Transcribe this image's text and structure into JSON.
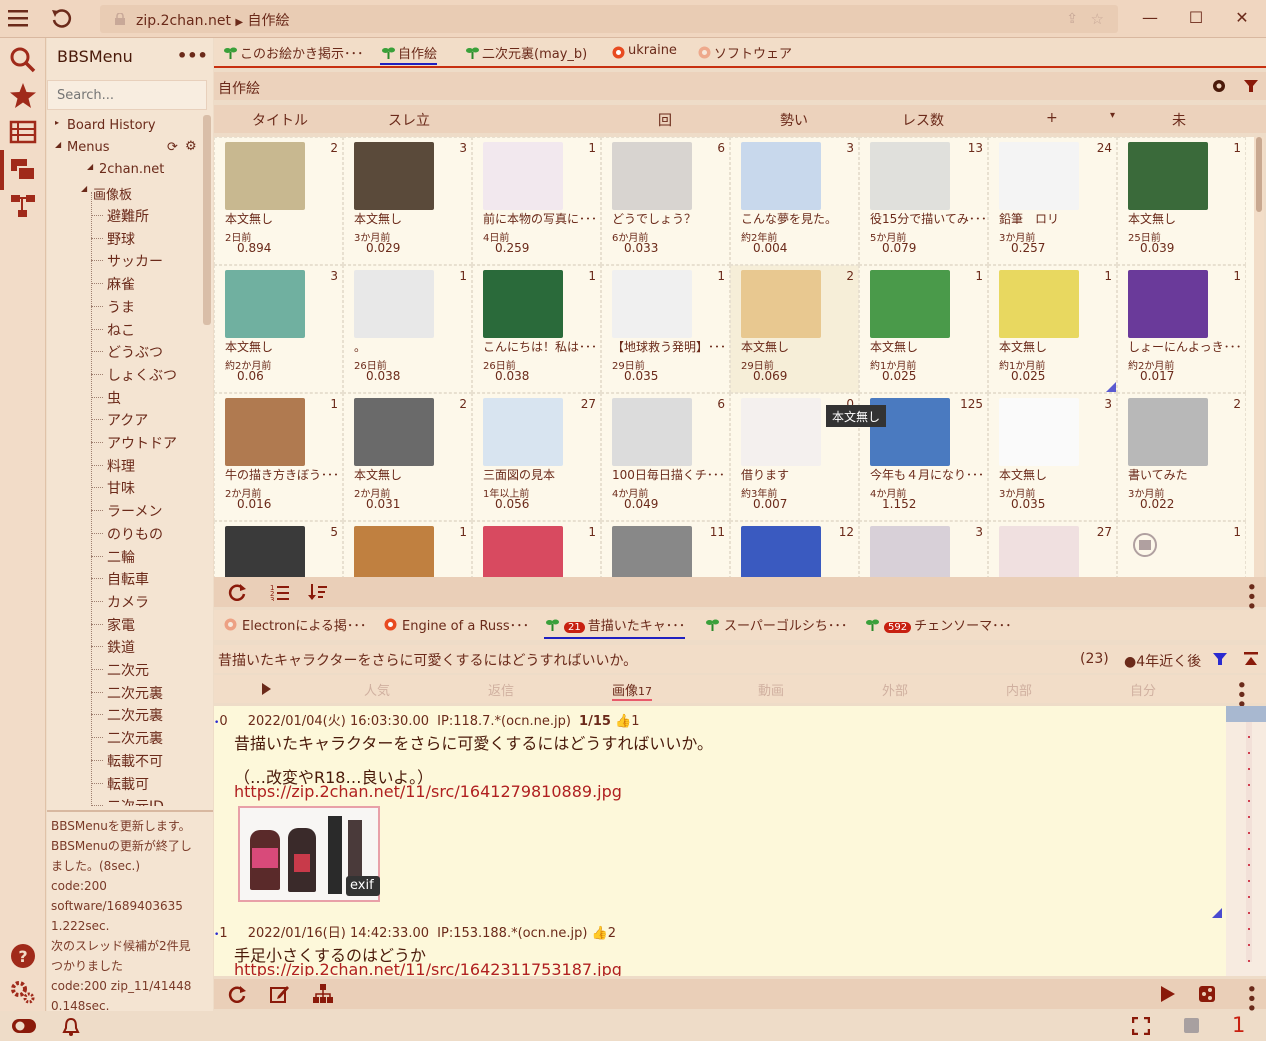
{
  "titlebar": {
    "address": "zip.2chan.net",
    "crumb": "自作絵"
  },
  "sidebar": {
    "title": "BBSMenu",
    "search_placeholder": "Search...",
    "tree": {
      "board_history": "Board History",
      "menus": "Menus",
      "site": "2chan.net",
      "category": "画像板",
      "boards": [
        "避難所",
        "野球",
        "サッカー",
        "麻雀",
        "うま",
        "ねこ",
        "どうぶつ",
        "しょくぶつ",
        "虫",
        "アクア",
        "アウトドア",
        "料理",
        "甘味",
        "ラーメン",
        "のりもの",
        "二輪",
        "自転車",
        "カメラ",
        "家電",
        "鉄道",
        "二次元",
        "二次元裏",
        "二次元裏",
        "二次元裏",
        "転載不可",
        "転載可",
        "二次元ID"
      ]
    },
    "log": [
      "BBSMenuを更新します。",
      "BBSMenuの更新が終了し",
      "ました。(8sec.)",
      "code:200",
      "software/1689403635",
      "1.222sec.",
      "次のスレッド候補が2件見",
      "つかりました",
      "code:200 zip_11/41448",
      "0.148sec."
    ]
  },
  "board_tabs": [
    {
      "label": "このお絵かき掲示･･･",
      "icon": "sprout-icon"
    },
    {
      "label": "自作絵",
      "icon": "sprout-icon",
      "active": true
    },
    {
      "label": "二次元裏(may_b)",
      "icon": "sprout-icon"
    },
    {
      "label": "ukraine",
      "icon": "record-icon"
    },
    {
      "label": "ソフトウェア",
      "icon": "record-icon"
    }
  ],
  "board": {
    "title": "自作絵",
    "columns": [
      "タイトル",
      "スレ立",
      "回",
      "勢い",
      "レス数",
      "+",
      "▾",
      "未"
    ]
  },
  "threads": [
    {
      "title": "本文無し",
      "age": "2日前",
      "speed": "0.894",
      "count": "2",
      "thumb": "#c8b890"
    },
    {
      "title": "本文無し",
      "age": "3か月前",
      "speed": "0.029",
      "count": "3",
      "thumb": "#5a4a3a"
    },
    {
      "title": "前に本物の写真に･･･",
      "age": "4日前",
      "speed": "0.259",
      "count": "1",
      "thumb": "#f2e8ee"
    },
    {
      "title": "どうでしょう？",
      "age": "6か月前",
      "speed": "0.033",
      "count": "6",
      "thumb": "#d8d4d0"
    },
    {
      "title": "こんな夢を見た。",
      "age": "約2年前",
      "speed": "0.004",
      "count": "3",
      "thumb": "#c8d8ec"
    },
    {
      "title": "役15分で描いてみ･･･",
      "age": "5か月前",
      "speed": "0.079",
      "count": "13",
      "thumb": "#e0e0dc"
    },
    {
      "title": "鉛筆　ロリ",
      "age": "3か月前",
      "speed": "0.257",
      "count": "24",
      "thumb": "#f4f4f4"
    },
    {
      "title": "本文無し",
      "age": "25日前",
      "speed": "0.039",
      "count": "1",
      "thumb": "#3a6a3a"
    },
    {
      "title": "本文無し",
      "age": "約2か月前",
      "speed": "0.06",
      "count": "3",
      "thumb": "#70b0a0"
    },
    {
      "title": "。",
      "age": "26日前",
      "speed": "0.038",
      "count": "1",
      "thumb": "#e8e8e8"
    },
    {
      "title": "こんにちは！私は･･･",
      "age": "26日前",
      "speed": "0.038",
      "count": "1",
      "thumb": "#2a6a3a"
    },
    {
      "title": "【地球救う発明】･･･",
      "age": "29日前",
      "speed": "0.035",
      "count": "1",
      "thumb": "#f0f0f0"
    },
    {
      "title": "本文無し",
      "age": "29日前",
      "speed": "0.069",
      "count": "2",
      "thumb": "#e8c890"
    },
    {
      "title": "本文無し",
      "age": "約1か月前",
      "speed": "0.025",
      "count": "1",
      "thumb": "#4a9a4a"
    },
    {
      "title": "本文無し",
      "age": "約1か月前",
      "speed": "0.025",
      "count": "1",
      "thumb": "#e8d860"
    },
    {
      "title": "しょーにんよっき･･･",
      "age": "約2か月前",
      "speed": "0.017",
      "count": "1",
      "thumb": "#6a3a9a"
    },
    {
      "title": "牛の描き方きぼう･･･",
      "age": "2か月前",
      "speed": "0.016",
      "count": "1",
      "thumb": "#b07a50"
    },
    {
      "title": "本文無し",
      "age": "2か月前",
      "speed": "0.031",
      "count": "2",
      "thumb": "#6a6a6a"
    },
    {
      "title": "三面図の見本",
      "age": "1年以上前",
      "speed": "0.056",
      "count": "27",
      "thumb": "#d8e4f0"
    },
    {
      "title": "100日毎日描くチ･･･",
      "age": "4か月前",
      "speed": "0.049",
      "count": "6",
      "thumb": "#dcdcdc"
    },
    {
      "title": "借ります",
      "age": "約3年前",
      "speed": "0.007",
      "count": "0",
      "thumb": "#f4f0ee"
    },
    {
      "title": "今年も４月になり･･･",
      "age": "4か月前",
      "speed": "1.152",
      "count": "125",
      "thumb": "#4a7ac0"
    },
    {
      "title": "本文無し",
      "age": "3か月前",
      "speed": "0.035",
      "count": "3",
      "thumb": "#fafafa"
    },
    {
      "title": "書いてみた",
      "age": "3か月前",
      "speed": "0.022",
      "count": "2",
      "thumb": "#b8b8b8"
    },
    {
      "title": "",
      "age": "",
      "speed": "",
      "count": "5",
      "thumb": "#3a3a3a"
    },
    {
      "title": "",
      "age": "",
      "speed": "",
      "count": "1",
      "thumb": "#c08040"
    },
    {
      "title": "",
      "age": "",
      "speed": "",
      "count": "1",
      "thumb": "#d84a60"
    },
    {
      "title": "",
      "age": "",
      "speed": "",
      "count": "11",
      "thumb": "#888888"
    },
    {
      "title": "",
      "age": "",
      "speed": "",
      "count": "12",
      "thumb": "#3a5ac0"
    },
    {
      "title": "",
      "age": "",
      "speed": "",
      "count": "3",
      "thumb": "#d8d0d8"
    },
    {
      "title": "",
      "age": "",
      "speed": "",
      "count": "27",
      "thumb": "#f0e0e0"
    },
    {
      "title": "",
      "age": "",
      "speed": "",
      "count": "1",
      "thumb": "#fdf8ea"
    }
  ],
  "tooltip": "本文無し",
  "thread_tabs": [
    {
      "label": "Electronによる掲･･･",
      "icon": "record-icon"
    },
    {
      "label": "Engine of a Russ･･･",
      "icon": "record-icon"
    },
    {
      "badge": "21",
      "label": "昔描いたキャ･･･",
      "icon": "sprout-icon",
      "active": true
    },
    {
      "label": "スーパーゴルシち･･･",
      "icon": "sprout-icon"
    },
    {
      "badge": "592",
      "label": "チェンソーマ･･･",
      "icon": "sprout-icon"
    }
  ],
  "thread": {
    "title": "昔描いたキャラクターをさらに可愛くするにはどうすればいいか。",
    "res_count": "(23)",
    "expire": "4年近く後",
    "filters": [
      "人気",
      "返信",
      "画像",
      "動画",
      "外部",
      "内部",
      "自分"
    ],
    "image_count": "17"
  },
  "posts": [
    {
      "no": "0",
      "date": "2022/01/04(火) 16:03:30.00",
      "ip": "IP:118.7.*(ocn.ne.jp)",
      "pos": "1/15",
      "likes": "1",
      "lines": [
        "昔描いたキャラクターをさらに可愛くするにはどうすればいいか。",
        "",
        "（…改変やR18…良いよ。）"
      ],
      "link": "https://zip.2chan.net/11/src/1641279810889.jpg",
      "exif": "exif"
    },
    {
      "no": "1",
      "date": "2022/01/16(日) 14:42:33.00",
      "ip": "IP:153.188.*(ocn.ne.jp)",
      "likes": "2",
      "lines": [
        "手足小さくするのはどうか"
      ],
      "link": "https://zip.2chan.net/11/src/1642311753187.jpg"
    }
  ],
  "status": {
    "count": "1"
  },
  "colors": {
    "accent": "#c83010",
    "bg": "#eedcc8",
    "panel": "#fdf8ea",
    "link": "#b02020"
  }
}
